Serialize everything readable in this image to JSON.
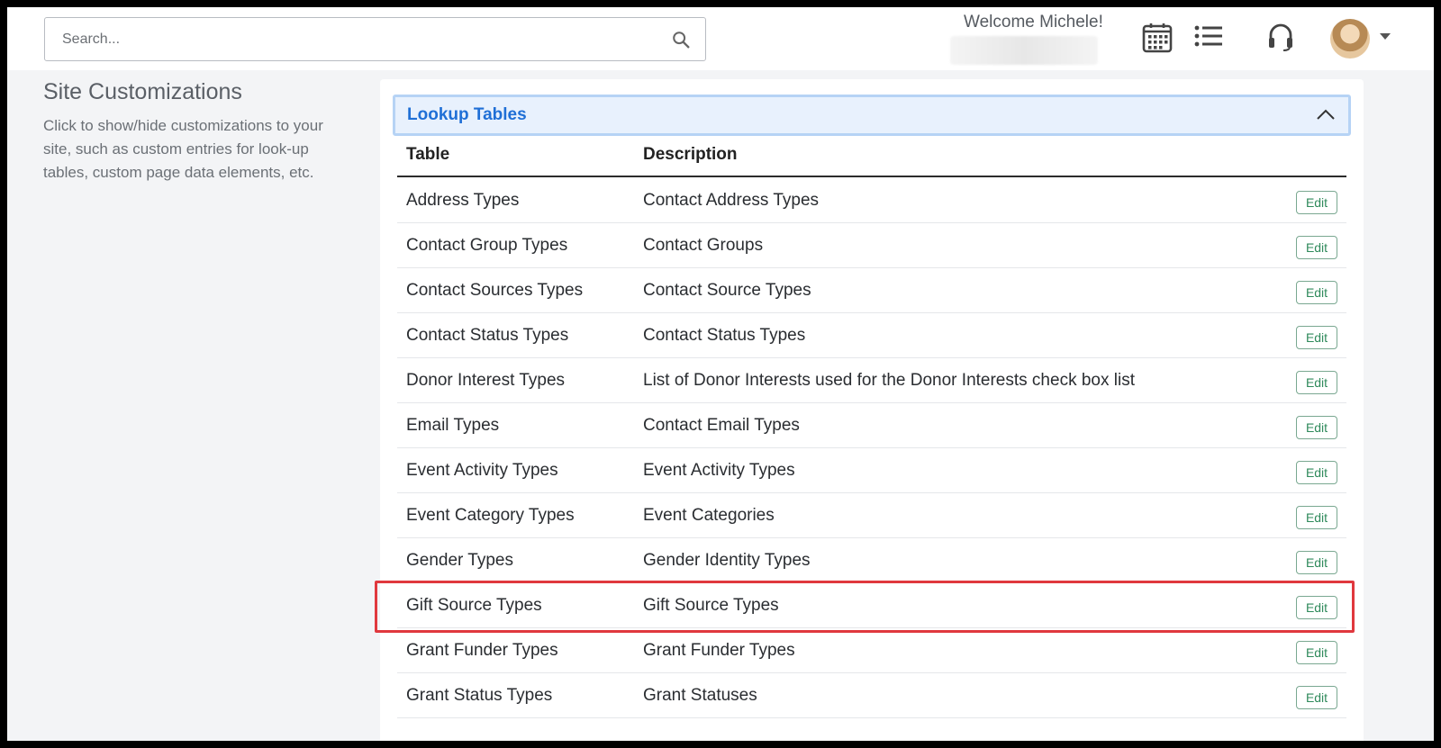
{
  "search": {
    "placeholder": "Search..."
  },
  "header": {
    "welcome": "Welcome Michele!",
    "icons": [
      "search-icon",
      "calendar-icon",
      "list-icon",
      "headset-icon",
      "avatar",
      "chevron-down-icon"
    ]
  },
  "sidebar": {
    "title": "Site Customizations",
    "description": "Click to show/hide customizations to your site, such as custom entries for look-up tables, custom page data elements, etc."
  },
  "lookup": {
    "title": "Lookup Tables",
    "expanded": true,
    "columns": {
      "table": "Table",
      "description": "Description"
    },
    "edit_label": "Edit",
    "rows": [
      {
        "table": "Address Types",
        "description": "Contact Address Types",
        "edit": "Edit"
      },
      {
        "table": "Contact Group Types",
        "description": "Contact Groups",
        "edit": "Edit"
      },
      {
        "table": "Contact Sources Types",
        "description": "Contact Source Types",
        "edit": "Edit"
      },
      {
        "table": "Contact Status Types",
        "description": "Contact Status Types",
        "edit": "Edit"
      },
      {
        "table": "Donor Interest Types",
        "description": "List of Donor Interests used for the Donor Interests check box list",
        "edit": "Edit"
      },
      {
        "table": "Email Types",
        "description": "Contact Email Types",
        "edit": "Edit"
      },
      {
        "table": "Event Activity Types",
        "description": "Event Activity Types",
        "edit": "Edit"
      },
      {
        "table": "Event Category Types",
        "description": "Event Categories",
        "edit": "Edit"
      },
      {
        "table": "Gender Types",
        "description": "Gender Identity Types",
        "edit": "Edit"
      },
      {
        "table": "Gift Source Types",
        "description": "Gift Source Types",
        "edit": "Edit"
      },
      {
        "table": "Grant Funder Types",
        "description": "Grant Funder Types",
        "edit": "Edit"
      },
      {
        "table": "Grant Status Types",
        "description": "Grant Statuses",
        "edit": "Edit"
      }
    ],
    "highlighted_row": "Gift Source Types"
  },
  "colors": {
    "accent": "#1f6fd6",
    "accordion_bg": "#e8f1fd",
    "edit_green": "#2f8a5b",
    "highlight_red": "#e0383e"
  }
}
